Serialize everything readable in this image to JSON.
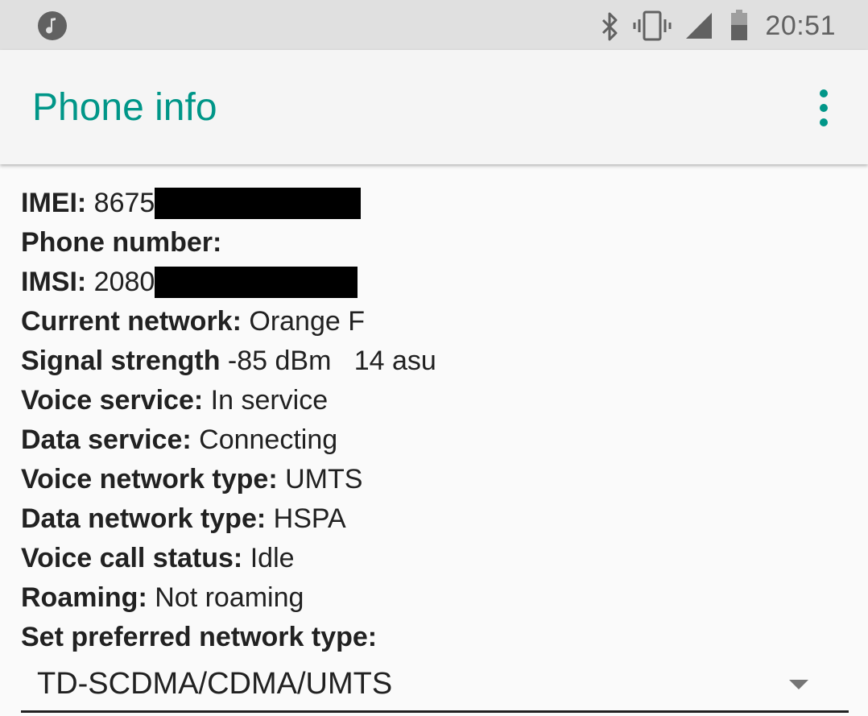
{
  "status_bar": {
    "time": "20:51",
    "icons": [
      "music-note-icon",
      "bluetooth-icon",
      "vibrate-icon",
      "signal-icon",
      "battery-icon"
    ]
  },
  "app_bar": {
    "title": "Phone info",
    "menu_icon": "more-vert-icon"
  },
  "info": {
    "imei": {
      "label": "IMEI:",
      "value": "8675"
    },
    "phone_number": {
      "label": "Phone number:",
      "value": ""
    },
    "imsi": {
      "label": "IMSI:",
      "value": "2080"
    },
    "current_network": {
      "label": "Current network:",
      "value": "Orange F"
    },
    "signal_strength": {
      "label": "Signal strength",
      "value": "-85 dBm   14 asu"
    },
    "voice_service": {
      "label": "Voice service:",
      "value": "In service"
    },
    "data_service": {
      "label": "Data service:",
      "value": "Connecting"
    },
    "voice_network_type": {
      "label": "Voice network type:",
      "value": "UMTS"
    },
    "data_network_type": {
      "label": "Data network type:",
      "value": "HSPA"
    },
    "voice_call_status": {
      "label": "Voice call status:",
      "value": "Idle"
    },
    "roaming": {
      "label": "Roaming:",
      "value": "Not roaming"
    },
    "preferred_network": {
      "label": "Set preferred network type:"
    }
  },
  "spinner": {
    "selected": "TD-SCDMA/CDMA/UMTS"
  },
  "colors": {
    "accent": "#009688",
    "status_bar": "#e0e0e0",
    "app_bar": "#f5f5f5",
    "background": "#fafafa"
  }
}
